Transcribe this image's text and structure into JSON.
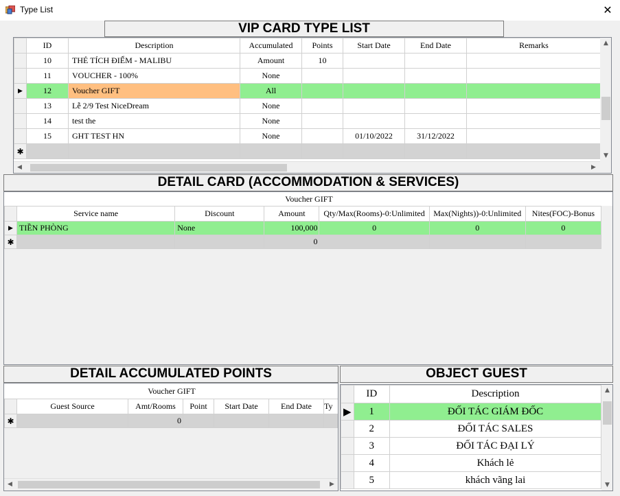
{
  "window": {
    "title": "Type List",
    "close_glyph": "✕"
  },
  "vip": {
    "title": "VIP CARD TYPE LIST",
    "columns": [
      "ID",
      "Description",
      "Accumulated",
      "Points",
      "Start Date",
      "End Date",
      "Remarks"
    ],
    "rows": [
      {
        "id": "10",
        "desc": "THẺ TÍCH ĐIỂM - MALIBU",
        "acc": "Amount",
        "points": "10",
        "start": "",
        "end": "",
        "remarks": ""
      },
      {
        "id": "11",
        "desc": "VOUCHER - 100%",
        "acc": "None",
        "points": "",
        "start": "",
        "end": "",
        "remarks": ""
      },
      {
        "id": "12",
        "desc": "Voucher GIFT",
        "acc": "All",
        "points": "",
        "start": "",
        "end": "",
        "remarks": ""
      },
      {
        "id": "13",
        "desc": "Lễ 2/9 Test NiceDream",
        "acc": "None",
        "points": "",
        "start": "",
        "end": "",
        "remarks": ""
      },
      {
        "id": "14",
        "desc": "test the",
        "acc": "None",
        "points": "",
        "start": "",
        "end": "",
        "remarks": ""
      },
      {
        "id": "15",
        "desc": "GHT TEST HN",
        "acc": "None",
        "points": "",
        "start": "01/10/2022",
        "end": "31/12/2022",
        "remarks": ""
      }
    ],
    "selected_index": 2
  },
  "detail_card": {
    "title": "DETAIL CARD (ACCOMMODATION & SERVICES)",
    "caption": "Voucher GIFT",
    "columns": [
      "Service name",
      "Discount",
      "Amount",
      "Qty/Max(Rooms)-0:Unlimited",
      "Max(Nights))-0:Unlimited",
      "Nites(FOC)-Bonus"
    ],
    "rows": [
      {
        "service": "TIỀN PHÒNG",
        "discount": "None",
        "amount": "100,000",
        "qty": "0",
        "nights": "0",
        "nites": "0"
      }
    ],
    "new_row_amount": "0"
  },
  "points": {
    "title": "DETAIL ACCUMULATED POINTS",
    "caption": "Voucher GIFT",
    "columns": [
      "Guest Source",
      "Amt/Rooms",
      "Point",
      "Start Date",
      "End Date",
      "Ty"
    ],
    "new_row_amt": "0"
  },
  "object_guest": {
    "title": "OBJECT GUEST",
    "columns": [
      "ID",
      "Description"
    ],
    "rows": [
      {
        "id": "1",
        "desc": "ĐỐI TÁC GIÁM ĐỐC"
      },
      {
        "id": "2",
        "desc": "ĐỐI TÁC SALES"
      },
      {
        "id": "3",
        "desc": "ĐỐI TÁC ĐẠI LÝ"
      },
      {
        "id": "4",
        "desc": "Khách lẻ"
      },
      {
        "id": "5",
        "desc": "khách vãng lai"
      }
    ],
    "selected_index": 0
  },
  "colors": {
    "selected": "#90ee90",
    "highlight_cell": "#ffbf80",
    "new_row": "#d3d3d3"
  },
  "icons": {
    "current_row": "row-pointer-icon",
    "new_row": "new-row-asterisk-icon"
  }
}
